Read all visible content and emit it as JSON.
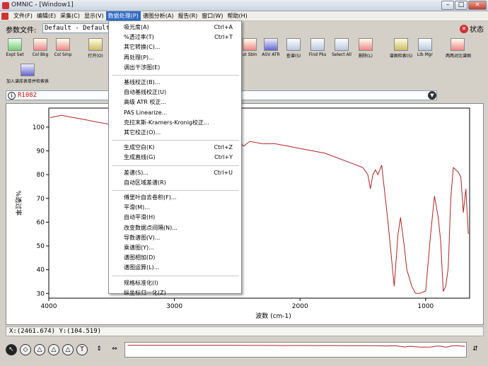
{
  "window": {
    "title": "OMNIC - [Window1]"
  },
  "menubar": {
    "items": [
      "文件(F)",
      "编辑(E)",
      "采集(C)",
      "显示(V)",
      "数据处理(P)",
      "谱图分析(A)",
      "报告(R)",
      "窗口(W)",
      "帮助(H)"
    ],
    "active_index": 4
  },
  "params": {
    "label": "参数文件:",
    "value": "Default - Default",
    "status_label": "状态"
  },
  "toolbar": {
    "row1": [
      "Expt Set",
      "Col Bkg",
      "Col Smp",
      "打开(O)",
      "",
      "",
      "",
      "",
      "",
      "",
      "ut Sbln",
      "ASV ATR",
      "查谱(S)",
      "Find Pks",
      "Select All",
      "删除(L)",
      "谱图检索(S)",
      "Lib Mgr",
      "两两对比谱图"
    ],
    "row2": [
      "加入谱库表单并检索表"
    ]
  },
  "spectrum": {
    "name": "R1082"
  },
  "dropdown": {
    "items": [
      {
        "label": "吸光度(A)",
        "shortcut": "Ctrl+A"
      },
      {
        "label": "%透过率(T)",
        "shortcut": "Ctrl+T"
      },
      {
        "label": "其它转换(C)...",
        "shortcut": ""
      },
      {
        "label": "再处理(P)...",
        "shortcut": ""
      },
      {
        "label": "调出干涉图(E)",
        "shortcut": ""
      },
      {
        "sep": true
      },
      {
        "label": "基线校正(B)...",
        "shortcut": ""
      },
      {
        "label": "自动基线校正(U)",
        "shortcut": ""
      },
      {
        "label": "高级 ATR 校正...",
        "shortcut": ""
      },
      {
        "label": "PAS Linearize...",
        "shortcut": ""
      },
      {
        "label": "克拉末斯-Kramers-Kronig校正...",
        "shortcut": ""
      },
      {
        "label": "其它校正(O)...",
        "shortcut": ""
      },
      {
        "sep": true
      },
      {
        "label": "生成空白(K)",
        "shortcut": "Ctrl+Z"
      },
      {
        "label": "生成直线(G)",
        "shortcut": "Ctrl+Y"
      },
      {
        "sep": true
      },
      {
        "label": "差谱(S)...",
        "shortcut": "Ctrl+U"
      },
      {
        "label": "自动区域差谱(R)",
        "shortcut": ""
      },
      {
        "sep": true
      },
      {
        "label": "傅里叶自去卷积(F)...",
        "shortcut": ""
      },
      {
        "label": "平滑(M)...",
        "shortcut": ""
      },
      {
        "label": "自动平滑(H)",
        "shortcut": ""
      },
      {
        "label": "改变数据点间隔(N)...",
        "shortcut": ""
      },
      {
        "label": "导数谱图(V)...",
        "shortcut": ""
      },
      {
        "label": "乘谱图(Y)...",
        "shortcut": ""
      },
      {
        "label": "谱图相加(D)",
        "shortcut": ""
      },
      {
        "label": "谱图运算(L)...",
        "shortcut": ""
      },
      {
        "sep": true
      },
      {
        "label": "规格标准化(I)",
        "shortcut": ""
      },
      {
        "label": "纵坐标归一化(Z)",
        "shortcut": ""
      }
    ]
  },
  "coords": {
    "text": "X:(2461.674)  Y:(104.519)"
  },
  "chart_data": {
    "type": "line",
    "title": "",
    "xlabel": "波数 (cm-1)",
    "ylabel": "%透过率",
    "xlim": [
      4000,
      650
    ],
    "ylim": [
      28,
      108
    ],
    "x_ticks": [
      4000,
      3000,
      2000,
      1000
    ],
    "y_ticks": [
      30,
      40,
      50,
      60,
      70,
      80,
      90,
      100
    ],
    "color": "#b22222",
    "series": [
      {
        "x": [
          3990,
          3900,
          3800,
          3700,
          3600,
          3500,
          3400,
          3300,
          3200,
          3100,
          3000,
          2900,
          2800,
          2700,
          2600,
          2500,
          2450,
          2400,
          2300,
          2200,
          2100,
          2000,
          1900,
          1800,
          1700,
          1600,
          1500,
          1460,
          1440,
          1420,
          1400,
          1380,
          1350,
          1300,
          1250,
          1220,
          1200,
          1170,
          1150,
          1110,
          1080,
          1050,
          1000,
          960,
          930,
          900,
          880,
          860,
          840,
          820,
          800,
          780,
          760,
          740,
          720,
          700,
          680,
          660
        ],
        "y": [
          104,
          105,
          104,
          103,
          102,
          101,
          101,
          101,
          100,
          100,
          99,
          99,
          98,
          97,
          96,
          95,
          92,
          94,
          93,
          93,
          92,
          91,
          90,
          89,
          87,
          85,
          83,
          80,
          74,
          80,
          82,
          80,
          84,
          60,
          33,
          55,
          62,
          50,
          40,
          33,
          30,
          30,
          31,
          55,
          71,
          62,
          52,
          31,
          33,
          41,
          70,
          83,
          82,
          81,
          79,
          64,
          74,
          55
        ]
      }
    ]
  }
}
